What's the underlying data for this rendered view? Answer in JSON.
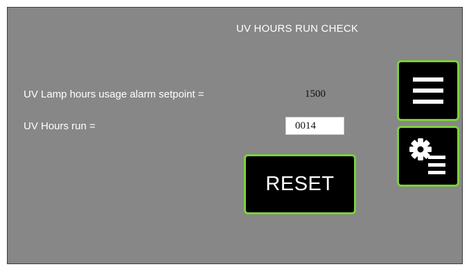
{
  "screen": {
    "title": "UV HOURS RUN CHECK",
    "setpoint_label": "UV Lamp hours usage alarm setpoint =",
    "setpoint_value": "1500",
    "hours_run_label": "UV Hours run =",
    "hours_run_value": "0014",
    "reset_label": "RESET"
  },
  "icons": {
    "menu": "hamburger-menu-icon",
    "settings": "gear-list-settings-icon"
  },
  "colors": {
    "background": "#868786",
    "button_fill": "#000000",
    "button_border": "#7ed03a",
    "text": "#ffffff",
    "value_box": "#ffffff"
  }
}
